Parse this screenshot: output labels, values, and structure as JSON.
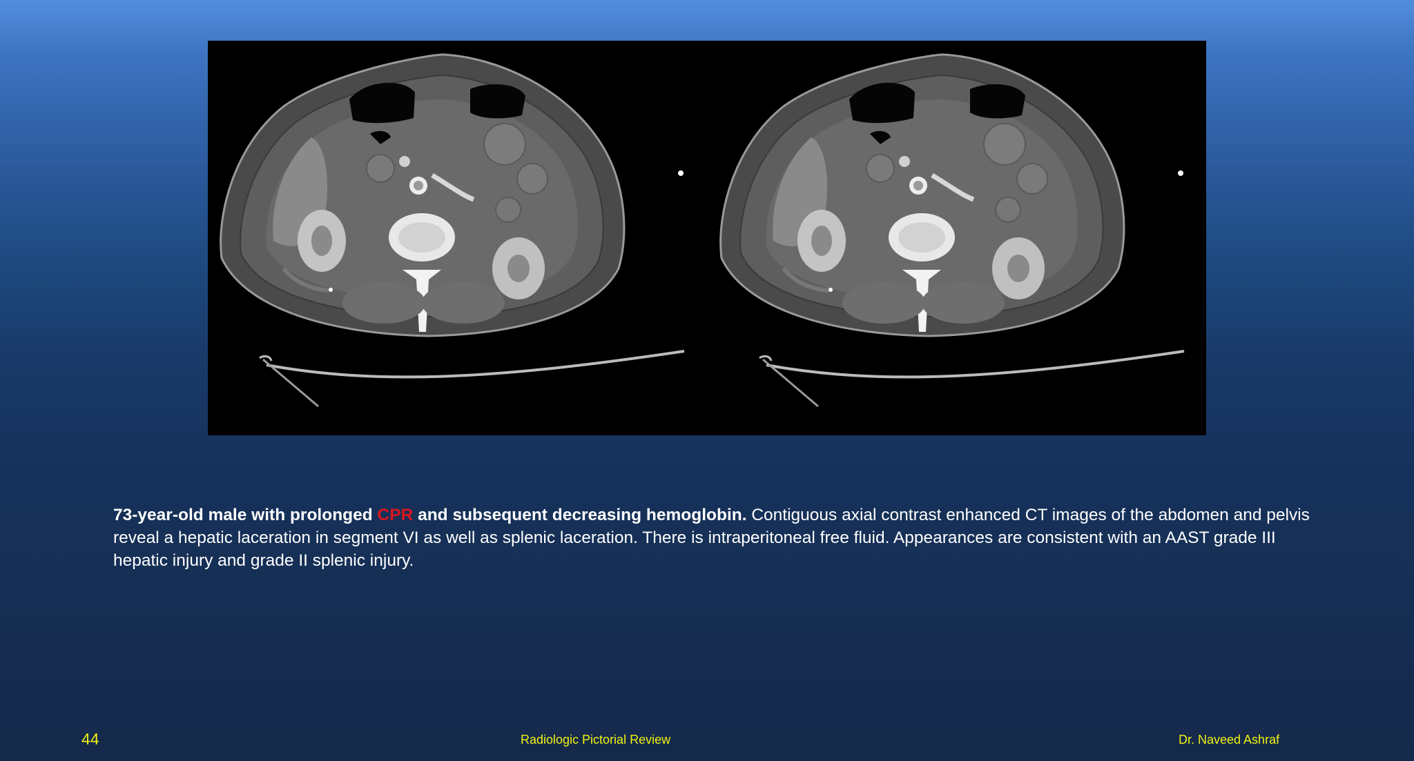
{
  "slide": {
    "number": "44",
    "footer_center": "Radiologic Pictorial Review",
    "footer_right": "Dr. Naveed Ashraf"
  },
  "caption": {
    "bold_lead": "73-year-old male with prolonged ",
    "highlight": "CPR",
    "bold_tail": " and subsequent decreasing hemoglobin.",
    "body": " Contiguous axial contrast enhanced CT images of the abdomen and pelvis reveal a hepatic laceration in segment VI as well as splenic laceration. There is intraperitoneal free fluid. Appearances are consistent with an AAST grade III hepatic injury and grade II splenic injury."
  },
  "figure": {
    "panels": [
      "ct-axial-image-1",
      "ct-axial-image-2"
    ]
  },
  "colors": {
    "footer_text": "#f1f212",
    "caption_highlight": "#d9161d",
    "caption_text": "#ffffff",
    "background_top": "#528ddc",
    "background_bottom": "#15294a"
  }
}
